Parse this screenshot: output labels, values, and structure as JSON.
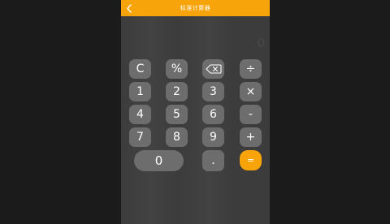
{
  "header": {
    "title": "标准计算器"
  },
  "display": {
    "value": "0"
  },
  "keys": {
    "clear": "C",
    "percent": "%",
    "divide": "÷",
    "seven": "7",
    "eight": "8",
    "nine": "9",
    "multiply": "×",
    "four": "4",
    "five": "5",
    "six": "6",
    "minus": "-",
    "one": "1",
    "two": "2",
    "three": "3",
    "plus": "+",
    "zero": "0",
    "decimal": ".",
    "equals": "="
  },
  "colors": {
    "accent": "#f7a40b",
    "key": "#6d6d6d",
    "background": "#3c3c3c"
  },
  "icons": {
    "back": "chevron-left-icon",
    "delete": "backspace-icon"
  }
}
